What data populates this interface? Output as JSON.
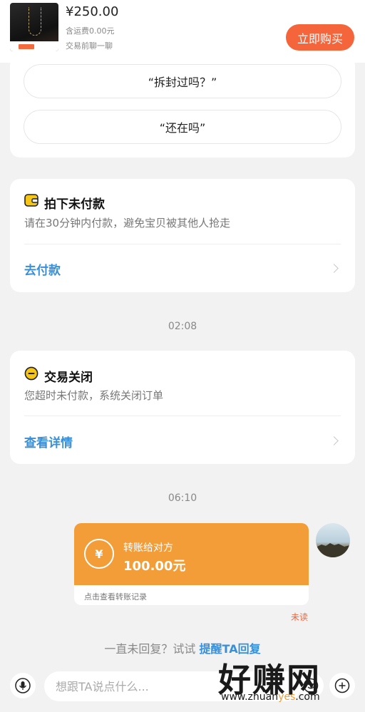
{
  "product": {
    "price": "¥250.00",
    "shipping": "含运费0.00元",
    "chat_hint": "交易前聊一聊",
    "buy_label": "立即购买"
  },
  "quick_replies": [
    "“拆封过吗？”",
    "“还在吗”"
  ],
  "unpaid_card": {
    "icon": "wallet-icon",
    "title": "拍下未付款",
    "desc": "请在30分钟内付款，避免宝贝被其他人抢走",
    "link": "去付款"
  },
  "time_1": "02:08",
  "closed_card": {
    "icon": "minus-circle-icon",
    "title": "交易关闭",
    "desc": "您超时未付款，系统关闭订单",
    "link": "查看详情"
  },
  "time_2": "06:10",
  "transfer": {
    "label": "转账给对方",
    "amount": "100.00元",
    "record": "点击查看转账记录",
    "status": "未读",
    "coin_symbol": "¥"
  },
  "remind": {
    "prefix": "一直未回复？试试 ",
    "link": "提醒TA回复"
  },
  "input": {
    "placeholder": "想跟TA说点什么..."
  },
  "watermark": {
    "main": "好赚网",
    "url_prefix": "www.zhuan",
    "url_accent": "yes",
    "url_suffix": ".com"
  },
  "colors": {
    "accent": "#f4653c",
    "link": "#3a8fd6",
    "transfer": "#f29d38"
  }
}
